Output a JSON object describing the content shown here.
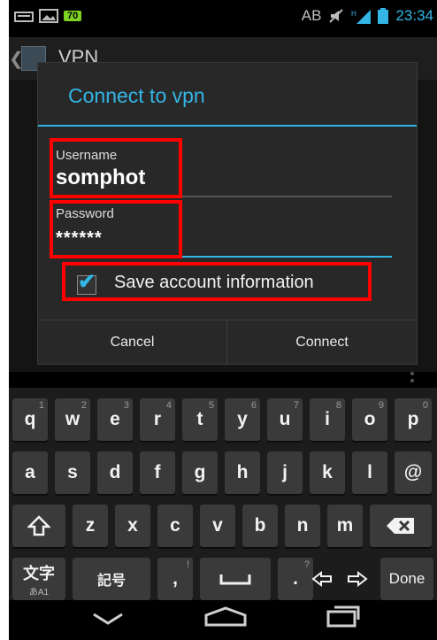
{
  "status_bar": {
    "carrier_text": "AB",
    "time": "23:34",
    "badge_text": "70"
  },
  "app_bar": {
    "title": "VPN"
  },
  "dialog": {
    "title": "Connect to vpn",
    "username_label": "Username",
    "username_value": "somphot",
    "password_label": "Password",
    "password_value": "******",
    "save_label": "Save account information",
    "save_checked": true,
    "cancel_label": "Cancel",
    "connect_label": "Connect"
  },
  "keyboard": {
    "row1": [
      {
        "key": "q",
        "sub": "1"
      },
      {
        "key": "w",
        "sub": "2"
      },
      {
        "key": "e",
        "sub": "3"
      },
      {
        "key": "r",
        "sub": "4"
      },
      {
        "key": "t",
        "sub": "5"
      },
      {
        "key": "y",
        "sub": "6"
      },
      {
        "key": "u",
        "sub": "7"
      },
      {
        "key": "i",
        "sub": "8"
      },
      {
        "key": "o",
        "sub": "9"
      },
      {
        "key": "p",
        "sub": "0"
      }
    ],
    "row2": [
      "a",
      "s",
      "d",
      "f",
      "g",
      "h",
      "j",
      "k",
      "l",
      "@"
    ],
    "row3": [
      "z",
      "x",
      "c",
      "v",
      "b",
      "n",
      "m"
    ],
    "lang_key": "文字",
    "lang_sub": "あA1",
    "symbol_key": "記号",
    "comma_key": ",",
    "comma_sub": "!",
    "period_key": ".",
    "period_sub": "?",
    "done_key": "Done"
  },
  "colors": {
    "accent": "#33b5e5",
    "highlight": "#ff0000"
  }
}
